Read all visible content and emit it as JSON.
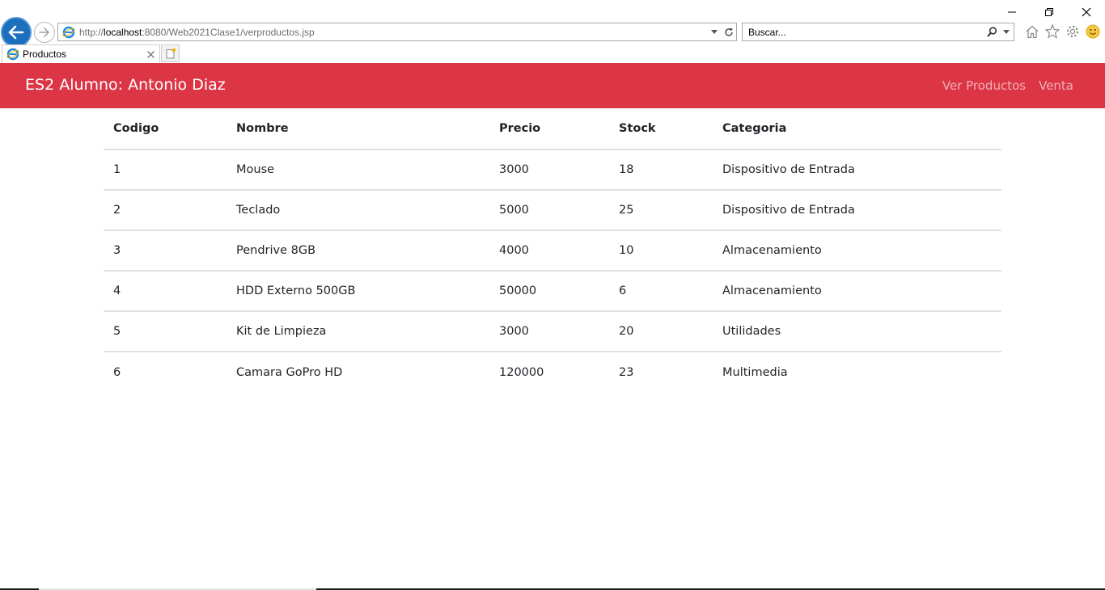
{
  "browser": {
    "url_prefix": "http://",
    "url_host": "localhost",
    "url_rest": ":8080/Web2021Clase1/verproductos.jsp",
    "search_placeholder": "Buscar...",
    "tab_title": "Productos",
    "icons": {
      "back": "back-arrow-icon",
      "forward": "forward-arrow-icon",
      "page_favicon": "ie-favicon-icon",
      "dropdown": "chevron-down-icon",
      "refresh": "refresh-icon",
      "search": "search-icon",
      "home": "home-icon",
      "favorites": "star-icon",
      "settings": "gear-icon",
      "feedback": "smiley-icon",
      "close_tab": "close-icon",
      "new_tab": "new-tab-icon",
      "minimize": "minimize-icon",
      "restore": "restore-icon",
      "close_window": "close-icon"
    }
  },
  "navbar": {
    "brand": "ES2 Alumno: Antonio Diaz",
    "links": [
      "Ver Productos",
      "Venta"
    ],
    "color": "#dc3545"
  },
  "table": {
    "headers": [
      "Codigo",
      "Nombre",
      "Precio",
      "Stock",
      "Categoria"
    ],
    "rows": [
      [
        "1",
        "Mouse",
        "3000",
        "18",
        "Dispositivo de Entrada"
      ],
      [
        "2",
        "Teclado",
        "5000",
        "25",
        "Dispositivo de Entrada"
      ],
      [
        "3",
        "Pendrive 8GB",
        "4000",
        "10",
        "Almacenamiento"
      ],
      [
        "4",
        "HDD Externo 500GB",
        "50000",
        "6",
        "Almacenamiento"
      ],
      [
        "5",
        "Kit de Limpieza",
        "3000",
        "20",
        "Utilidades"
      ],
      [
        "6",
        "Camara GoPro HD",
        "120000",
        "23",
        "Multimedia"
      ]
    ]
  }
}
